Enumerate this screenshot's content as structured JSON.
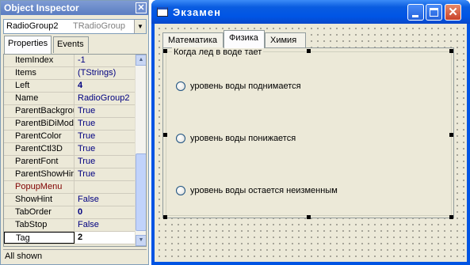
{
  "object_inspector": {
    "title": "Object Inspector",
    "close_glyph": "✕",
    "selected_component": {
      "name": "RadioGroup2",
      "type": "TRadioGroup"
    },
    "dropdown_glyph": "▼",
    "tabs": [
      {
        "label": "Properties",
        "active": true
      },
      {
        "label": "Events",
        "active": false
      }
    ],
    "properties": [
      {
        "name": "ItemIndex",
        "value": "-1"
      },
      {
        "name": "Items",
        "value": "(TStrings)"
      },
      {
        "name": "Left",
        "value": "4"
      },
      {
        "name": "Name",
        "value": "RadioGroup2"
      },
      {
        "name": "ParentBackground",
        "value": "True"
      },
      {
        "name": "ParentBiDiMode",
        "value": "True"
      },
      {
        "name": "ParentColor",
        "value": "True"
      },
      {
        "name": "ParentCtl3D",
        "value": "True"
      },
      {
        "name": "ParentFont",
        "value": "True"
      },
      {
        "name": "ParentShowHint",
        "value": "True"
      },
      {
        "name": "PopupMenu",
        "value": ""
      },
      {
        "name": "ShowHint",
        "value": "False"
      },
      {
        "name": "TabOrder",
        "value": "0"
      },
      {
        "name": "TabStop",
        "value": "False"
      },
      {
        "name": "Tag",
        "value": "2"
      }
    ],
    "status": "All shown",
    "scroll_up_glyph": "▲",
    "scroll_down_glyph": "▼"
  },
  "form": {
    "title": "Экзамен",
    "page_control": {
      "tabs": [
        {
          "label": "Математика",
          "active": false
        },
        {
          "label": "Физика",
          "active": true
        },
        {
          "label": "Химия",
          "active": false
        }
      ]
    },
    "radio_group": {
      "caption": "Когда лед в воде тает",
      "items": [
        "уровень воды поднимается",
        "уровень воды понижается",
        "уровень воды остается неизменным"
      ]
    }
  },
  "colors": {
    "titlebar_blue": "#0055e5",
    "inspector_title": "#6a8ccf",
    "property_value": "#000080",
    "event_property": "#800000"
  }
}
